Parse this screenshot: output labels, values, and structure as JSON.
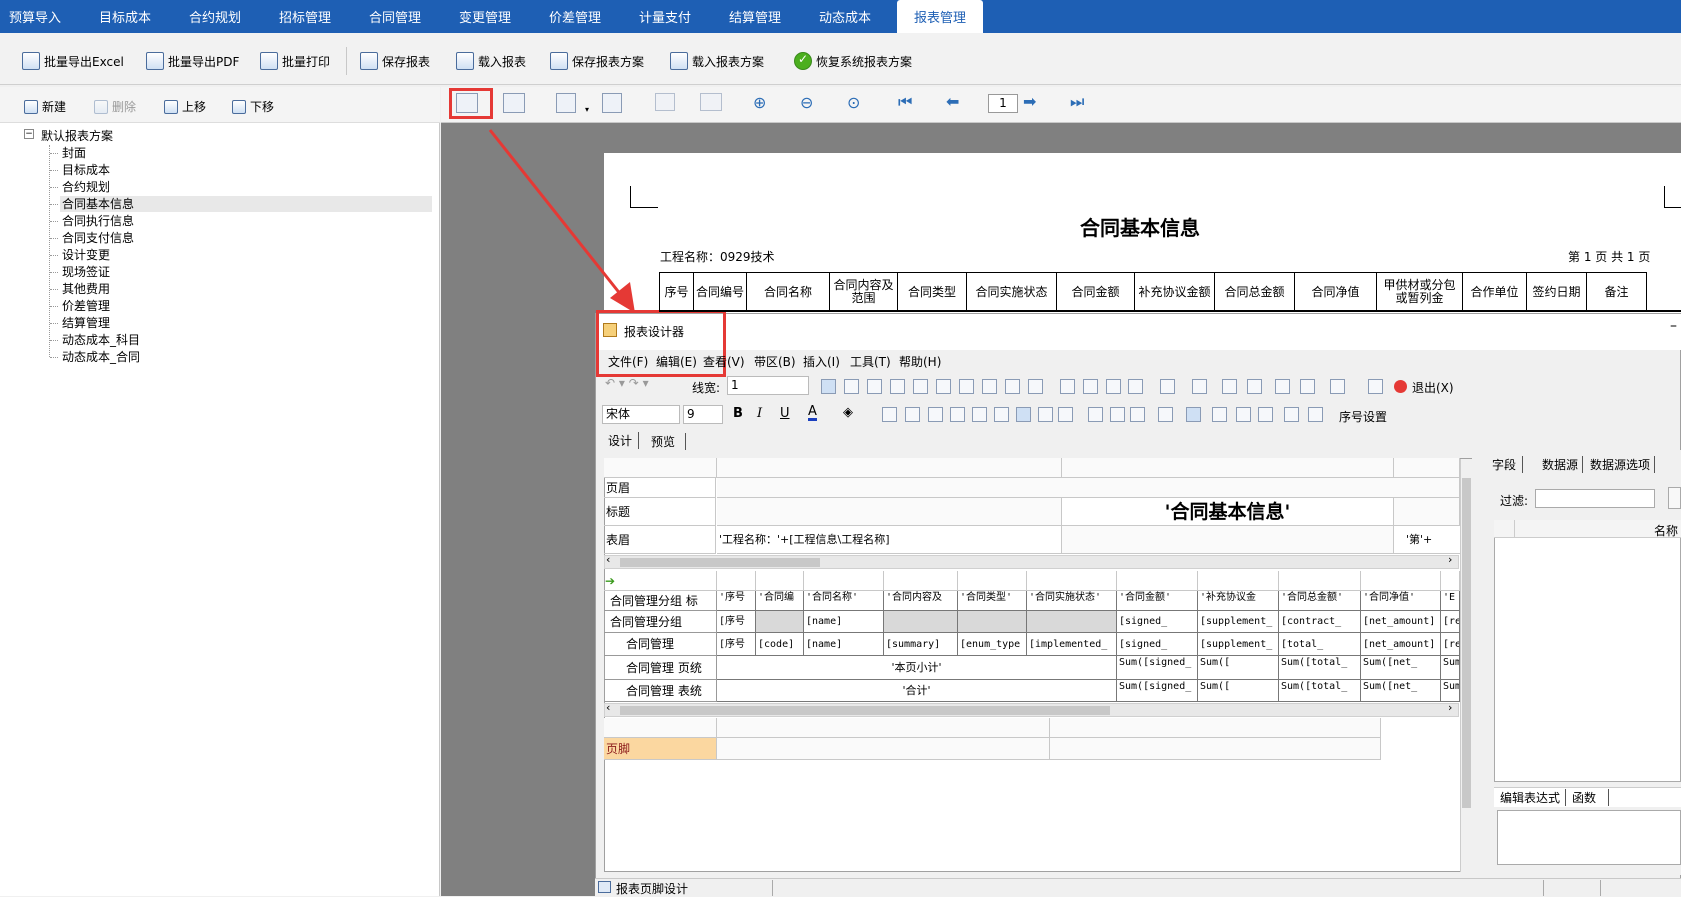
{
  "top_tabs": [
    {
      "label": "预算导入"
    },
    {
      "label": "目标成本"
    },
    {
      "label": "合约规划"
    },
    {
      "label": "招标管理"
    },
    {
      "label": "合同管理"
    },
    {
      "label": "变更管理"
    },
    {
      "label": "价差管理"
    },
    {
      "label": "计量支付"
    },
    {
      "label": "结算管理"
    },
    {
      "label": "动态成本"
    },
    {
      "label": "报表管理"
    }
  ],
  "toolbar": {
    "batch_excel": "批量导出Excel",
    "batch_pdf": "批量导出PDF",
    "batch_print": "批量打印",
    "save_report": "保存报表",
    "load_report": "载入报表",
    "save_scheme": "保存报表方案",
    "load_scheme": "载入报表方案",
    "restore_scheme": "恢复系统报表方案"
  },
  "left": {
    "new": "新建",
    "delete": "删除",
    "up": "上移",
    "down": "下移",
    "tree_root": "默认报表方案",
    "tree_items": [
      "封面",
      "目标成本",
      "合约规划",
      "合同基本信息",
      "合同执行信息",
      "合同支付信息",
      "设计变更",
      "现场签证",
      "其他费用",
      "价差管理",
      "结算管理",
      "动态成本_科目",
      "动态成本_合同"
    ],
    "selected": "合同基本信息"
  },
  "preview": {
    "page_number": "1",
    "paper_title": "合同基本信息",
    "project_name": "工程名称：0929技术",
    "page_info": "第 1 页  共 1 页",
    "table_headers": [
      "序号",
      "合同编号",
      "合同名称",
      "合同内容及范围",
      "合同类型",
      "合同实施状态",
      "合同金额",
      "补充协议金额",
      "合同总金额",
      "合同净值",
      "甲供材或分包或暂列金",
      "合作单位",
      "签约日期",
      "备注"
    ]
  },
  "designer": {
    "title": "报表设计器",
    "menus": [
      "文件(F)",
      "编辑(E)",
      "查看(V)",
      "带区(B)",
      "插入(I)",
      "工具(T)",
      "帮助(H)"
    ],
    "line_width_label": "线宽:",
    "line_width_value": "1",
    "exit": "退出(X)",
    "font": "宋体",
    "font_size": "9",
    "seq_setting": "序号设置",
    "tab_design": "设计",
    "tab_preview": "预览",
    "band_header": "页眉",
    "band_title": "标题",
    "band_table_header": "表眉",
    "title_expr": "'合同基本信息'",
    "project_expr": "'工程名称：'+[工程信息\\工程名称]",
    "page_expr": "'第'+",
    "rows": [
      {
        "label": "合同管理分组 标",
        "cells": [
          "'序号",
          "'合同编",
          "'合同名称'",
          "'合同内容及",
          "'合同类型'",
          "'合同实施状态'",
          "'合同金额'",
          "'补充协议金",
          "'合同总金额'",
          "'合同净值'",
          "'E"
        ]
      },
      {
        "label": "合同管理分组",
        "cells": [
          "[序号",
          "",
          "[name]",
          "",
          "",
          "",
          "[signed_",
          "[supplement_",
          "[contract_",
          "[net_amount]",
          "[re"
        ]
      },
      {
        "label": "合同管理",
        "cells": [
          "[序号",
          "[code]",
          "[name]",
          "[summary]",
          "[enum_type",
          "[implemented_",
          "[signed_",
          "[supplement_",
          "[total_",
          "[net_amount]",
          "[re"
        ]
      },
      {
        "label": "合同管理 页统",
        "cells": [
          "'本页小计'",
          "Sum([signed_",
          "Sum([",
          "Sum([total_",
          "Sum([net_",
          "Sum"
        ]
      },
      {
        "label": "合同管理 表统",
        "cells": [
          "'合计'",
          "Sum([signed_",
          "Sum([",
          "Sum([total_",
          "Sum([net_",
          "Sum"
        ]
      }
    ],
    "band_footer": "页脚",
    "right_tabs": [
      "字段",
      "数据源",
      "数据源选项"
    ],
    "filter_label": "过滤:",
    "name_col": "名称",
    "bottom_tabs": [
      "编辑表达式",
      "函数"
    ],
    "status_left": "报表页脚设计"
  },
  "colors": {
    "nav_bg": "#1e5fb4",
    "highlight": "#e53935",
    "footer_band": "#fbd7a0"
  }
}
